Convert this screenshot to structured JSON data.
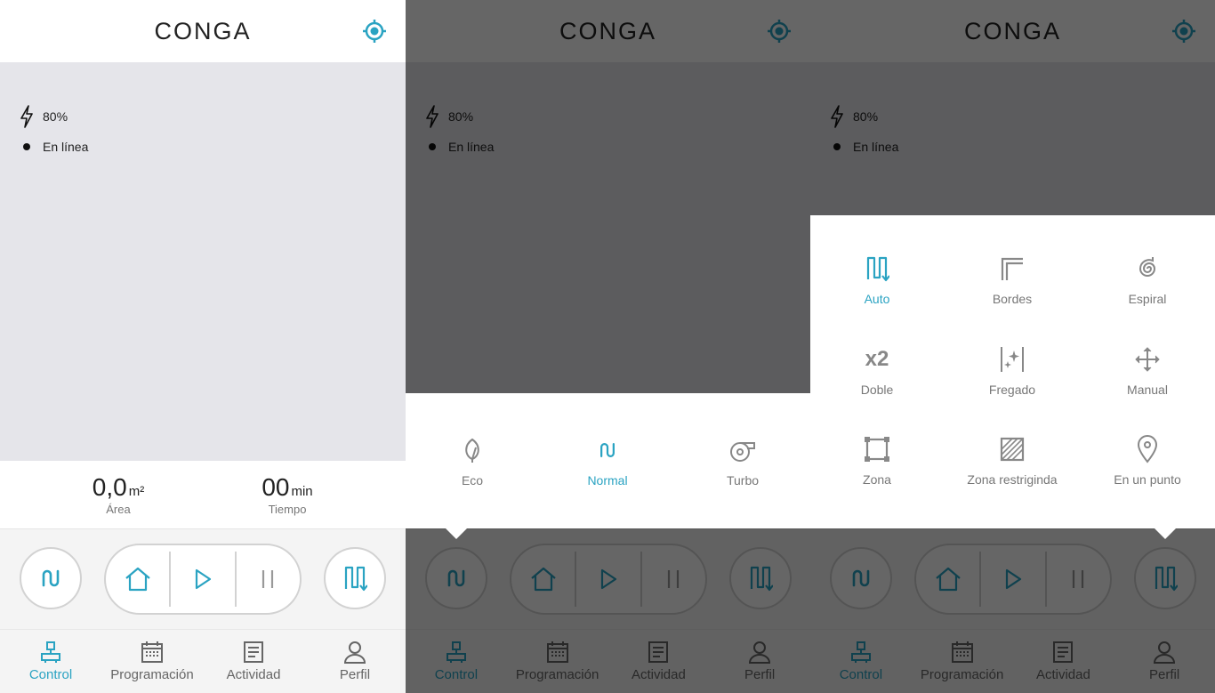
{
  "app": {
    "logo_text": "CONGA"
  },
  "colors": {
    "accent": "#2aa3c2",
    "map_bg": "#e5e5ea",
    "overlay": "rgba(0,0,0,0.6)",
    "muted": "#777777"
  },
  "status": {
    "battery": "80%",
    "connection": "En línea"
  },
  "stats": {
    "area_value": "0,0",
    "area_unit": "m²",
    "area_label": "Área",
    "time_value": "00",
    "time_unit": "min",
    "time_label": "Tiempo"
  },
  "controls": {
    "suction_icon": "wave-icon",
    "home_icon": "home-icon",
    "play_icon": "play-icon",
    "pause_icon": "pause-icon",
    "mode_icon": "auto-path-icon"
  },
  "nav": [
    {
      "label": "Control",
      "icon": "robot-icon",
      "active": true
    },
    {
      "label": "Programación",
      "icon": "calendar-icon",
      "active": false
    },
    {
      "label": "Actividad",
      "icon": "document-icon",
      "active": false
    },
    {
      "label": "Perfil",
      "icon": "user-icon",
      "active": false
    }
  ],
  "suction_panel": {
    "items": [
      {
        "label": "Eco",
        "icon": "leaf-icon",
        "selected": false
      },
      {
        "label": "Normal",
        "icon": "wave-icon",
        "selected": true
      },
      {
        "label": "Turbo",
        "icon": "turbo-fan-icon",
        "selected": false
      }
    ]
  },
  "mode_panel": {
    "items": [
      {
        "label": "Auto",
        "icon": "auto-path-icon",
        "selected": true
      },
      {
        "label": "Bordes",
        "icon": "edges-icon",
        "selected": false
      },
      {
        "label": "Espiral",
        "icon": "spiral-icon",
        "selected": false
      },
      {
        "label": "Doble",
        "icon": "x2-icon",
        "selected": false
      },
      {
        "label": "Fregado",
        "icon": "mop-sparkle-icon",
        "selected": false
      },
      {
        "label": "Manual",
        "icon": "move-arrows-icon",
        "selected": false
      },
      {
        "label": "Zona",
        "icon": "square-zone-icon",
        "selected": false
      },
      {
        "label": "Zona restriginda",
        "icon": "restricted-zone-icon",
        "selected": false
      },
      {
        "label": "En un punto",
        "icon": "map-pin-icon",
        "selected": false
      }
    ],
    "x2_text": "x2"
  }
}
